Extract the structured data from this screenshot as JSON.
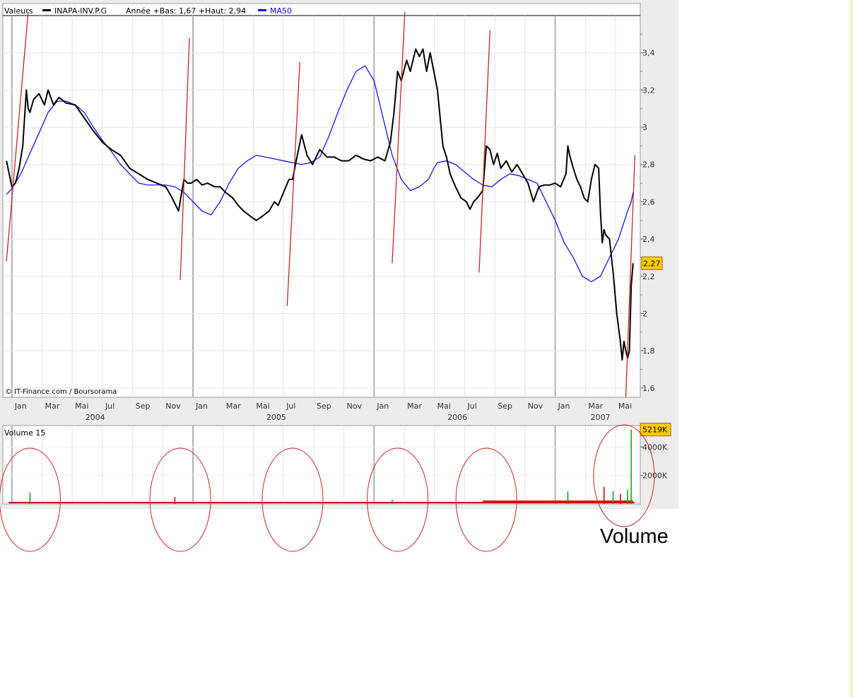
{
  "chart_data": {
    "type": "line",
    "header": {
      "values_label": "Valeurs",
      "series_label": "INAPA-INV.P.G",
      "range_label": "Année +Bas: 1,67 +Haut: 2,94",
      "ma_label": "MA50"
    },
    "credit": "© IT-Finance.com / Boursorama",
    "price_axis": {
      "ylim": [
        1.55,
        3.6
      ],
      "ticks": [
        1.6,
        1.8,
        2,
        2.2,
        2.4,
        2.6,
        2.8,
        3,
        3.2,
        3.4
      ],
      "tick_labels": [
        "1,6",
        "1,8",
        "2",
        "2,2",
        "2,4",
        "2,6",
        "2,8",
        "3",
        "3,2",
        "3,4"
      ],
      "last_value": 2.27,
      "last_value_label": "2,27"
    },
    "time_axis": {
      "xlim": [
        2003.95,
        2007.47
      ],
      "month_ticks": [
        2004.0,
        2004.167,
        2004.333,
        2004.5,
        2004.667,
        2004.833,
        2005.0,
        2005.167,
        2005.333,
        2005.5,
        2005.667,
        2005.833,
        2006.0,
        2006.167,
        2006.333,
        2006.5,
        2006.667,
        2006.833,
        2007.0,
        2007.167,
        2007.333
      ],
      "month_labels": [
        "Jan",
        "Mar",
        "Mai",
        "Jul",
        "Sep",
        "Nov",
        "Jan",
        "Mar",
        "Mai",
        "Jul",
        "Sep",
        "Nov",
        "Jan",
        "Mar",
        "Mai",
        "Jul",
        "Sep",
        "Nov",
        "Jan",
        "Mar",
        "Mai"
      ],
      "year_labels": [
        "2004",
        "2005",
        "2006",
        "2007"
      ],
      "year_label_positions": [
        2004.46,
        2005.46,
        2006.46,
        2007.25
      ]
    },
    "series": [
      {
        "name": "INAPA-INV.P.G",
        "color": "#000000",
        "x": [
          2003.97,
          2003.985,
          2004.0,
          2004.02,
          2004.04,
          2004.06,
          2004.08,
          2004.09,
          2004.1,
          2004.12,
          2004.15,
          2004.18,
          2004.2,
          2004.23,
          2004.26,
          2004.3,
          2004.35,
          2004.4,
          2004.45,
          2004.5,
          2004.55,
          2004.6,
          2004.65,
          2004.7,
          2004.75,
          2004.8,
          2004.85,
          2004.88,
          2004.92,
          2004.95,
          2004.97,
          2004.99,
          2005.02,
          2005.05,
          2005.08,
          2005.12,
          2005.15,
          2005.18,
          2005.22,
          2005.25,
          2005.28,
          2005.32,
          2005.35,
          2005.38,
          2005.42,
          2005.45,
          2005.47,
          2005.5,
          2005.53,
          2005.55,
          2005.57,
          2005.6,
          2005.63,
          2005.66,
          2005.7,
          2005.74,
          2005.78,
          2005.82,
          2005.86,
          2005.9,
          2005.94,
          2005.98,
          2006.02,
          2006.06,
          2006.09,
          2006.11,
          2006.13,
          2006.15,
          2006.18,
          2006.2,
          2006.23,
          2006.25,
          2006.27,
          2006.29,
          2006.31,
          2006.33,
          2006.35,
          2006.37,
          2006.38,
          2006.4,
          2006.42,
          2006.45,
          2006.48,
          2006.51,
          2006.53,
          2006.55,
          2006.57,
          2006.6,
          2006.62,
          2006.64,
          2006.66,
          2006.68,
          2006.7,
          2006.73,
          2006.76,
          2006.79,
          2006.82,
          2006.85,
          2006.88,
          2006.91,
          2006.94,
          2006.97,
          2007.0,
          2007.03,
          2007.06,
          2007.07,
          2007.08,
          2007.1,
          2007.12,
          2007.14,
          2007.16,
          2007.18,
          2007.2,
          2007.22,
          2007.24,
          2007.25,
          2007.26,
          2007.27,
          2007.28,
          2007.3,
          2007.32,
          2007.34,
          2007.36,
          2007.37,
          2007.38,
          2007.39,
          2007.4,
          2007.41,
          2007.42,
          2007.43
        ],
        "values": [
          2.82,
          2.75,
          2.68,
          2.7,
          2.78,
          2.9,
          3.2,
          3.1,
          3.08,
          3.15,
          3.18,
          3.12,
          3.2,
          3.12,
          3.16,
          3.13,
          3.12,
          3.05,
          2.98,
          2.92,
          2.88,
          2.85,
          2.78,
          2.75,
          2.72,
          2.7,
          2.68,
          2.63,
          2.55,
          2.72,
          2.7,
          2.7,
          2.72,
          2.69,
          2.7,
          2.68,
          2.68,
          2.65,
          2.62,
          2.58,
          2.55,
          2.52,
          2.5,
          2.52,
          2.55,
          2.6,
          2.58,
          2.65,
          2.72,
          2.72,
          2.82,
          2.96,
          2.85,
          2.8,
          2.88,
          2.84,
          2.84,
          2.82,
          2.82,
          2.85,
          2.83,
          2.82,
          2.84,
          2.82,
          2.92,
          3.08,
          3.3,
          3.25,
          3.36,
          3.3,
          3.42,
          3.38,
          3.42,
          3.3,
          3.4,
          3.3,
          3.2,
          3.0,
          2.9,
          2.84,
          2.75,
          2.68,
          2.62,
          2.6,
          2.56,
          2.6,
          2.62,
          2.66,
          2.9,
          2.88,
          2.8,
          2.86,
          2.78,
          2.82,
          2.76,
          2.8,
          2.75,
          2.7,
          2.6,
          2.68,
          2.69,
          2.69,
          2.7,
          2.68,
          2.75,
          2.9,
          2.85,
          2.78,
          2.72,
          2.68,
          2.62,
          2.6,
          2.72,
          2.8,
          2.78,
          2.55,
          2.38,
          2.45,
          2.42,
          2.4,
          2.22,
          2.0,
          1.85,
          1.75,
          1.85,
          1.8,
          1.76,
          1.8,
          2.15,
          2.27
        ]
      },
      {
        "name": "MA50",
        "color": "#0000ff",
        "x": [
          2003.97,
          2004.0,
          2004.05,
          2004.1,
          2004.15,
          2004.2,
          2004.25,
          2004.3,
          2004.35,
          2004.4,
          2004.45,
          2004.5,
          2004.55,
          2004.6,
          2004.65,
          2004.7,
          2004.75,
          2004.8,
          2004.85,
          2004.9,
          2004.95,
          2005.0,
          2005.05,
          2005.1,
          2005.15,
          2005.2,
          2005.25,
          2005.3,
          2005.35,
          2005.4,
          2005.45,
          2005.5,
          2005.55,
          2005.6,
          2005.65,
          2005.7,
          2005.75,
          2005.8,
          2005.85,
          2005.9,
          2005.95,
          2006.0,
          2006.05,
          2006.1,
          2006.15,
          2006.2,
          2006.25,
          2006.3,
          2006.33,
          2006.35,
          2006.4,
          2006.45,
          2006.5,
          2006.55,
          2006.6,
          2006.65,
          2006.7,
          2006.75,
          2006.8,
          2006.85,
          2006.9,
          2006.95,
          2007.0,
          2007.05,
          2007.1,
          2007.15,
          2007.2,
          2007.25,
          2007.3,
          2007.35,
          2007.4,
          2007.42,
          2007.43
        ],
        "values": [
          2.64,
          2.67,
          2.75,
          2.86,
          2.97,
          3.08,
          3.14,
          3.14,
          3.12,
          3.08,
          3.0,
          2.93,
          2.87,
          2.8,
          2.75,
          2.7,
          2.69,
          2.69,
          2.69,
          2.68,
          2.65,
          2.6,
          2.55,
          2.53,
          2.6,
          2.7,
          2.78,
          2.82,
          2.85,
          2.84,
          2.83,
          2.82,
          2.81,
          2.8,
          2.81,
          2.84,
          2.95,
          3.08,
          3.2,
          3.3,
          3.33,
          3.25,
          3.05,
          2.85,
          2.72,
          2.66,
          2.68,
          2.72,
          2.78,
          2.81,
          2.82,
          2.8,
          2.76,
          2.72,
          2.69,
          2.68,
          2.72,
          2.75,
          2.74,
          2.72,
          2.7,
          2.6,
          2.5,
          2.38,
          2.3,
          2.2,
          2.17,
          2.2,
          2.3,
          2.4,
          2.55,
          2.6,
          2.65
        ]
      }
    ],
    "trend_lines": [
      {
        "x": [
          2003.97,
          2004.09
        ],
        "values": [
          2.28,
          3.62
        ]
      },
      {
        "x": [
          2004.93,
          2004.98
        ],
        "values": [
          2.18,
          3.48
        ]
      },
      {
        "x": [
          2005.52,
          2005.59
        ],
        "values": [
          2.04,
          3.35
        ]
      },
      {
        "x": [
          2006.1,
          2006.17
        ],
        "values": [
          2.27,
          3.62
        ]
      },
      {
        "x": [
          2006.58,
          2006.64
        ],
        "values": [
          2.22,
          3.52
        ]
      },
      {
        "x": [
          2007.39,
          2007.44
        ],
        "values": [
          1.55,
          2.85
        ]
      }
    ],
    "volume": {
      "title": "Volume 15",
      "ylim": [
        0,
        5500
      ],
      "ticks": [
        2000,
        4000
      ],
      "tick_labels": [
        "2000K",
        "4000K"
      ],
      "last_label": "5219K",
      "spikes": [
        {
          "x": 2004.1,
          "value": 800,
          "color": "#00aa00"
        },
        {
          "x": 2004.9,
          "value": 500,
          "color": "#cc0000"
        },
        {
          "x": 2006.1,
          "value": 300,
          "color": "#00aa00"
        },
        {
          "x": 2007.07,
          "value": 900,
          "color": "#00aa00"
        },
        {
          "x": 2007.27,
          "value": 1200,
          "color": "#cc0000"
        },
        {
          "x": 2007.32,
          "value": 900,
          "color": "#00aa00"
        },
        {
          "x": 2007.36,
          "value": 700,
          "color": "#cc0000"
        },
        {
          "x": 2007.4,
          "value": 1000,
          "color": "#00aa00"
        },
        {
          "x": 2007.42,
          "value": 5219,
          "color": "#00aa00"
        }
      ],
      "highlight_circles": [
        2004.1,
        2004.93,
        2005.55,
        2006.13,
        2006.62,
        2007.38
      ]
    },
    "annotation": "Volume"
  }
}
